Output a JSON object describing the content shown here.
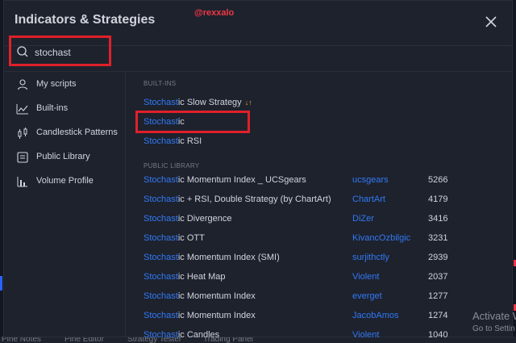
{
  "dialog": {
    "title": "Indicators & Strategies",
    "watermark": "@rexxalo"
  },
  "search": {
    "value": "stochast"
  },
  "sidebar": {
    "items": [
      {
        "label": "My scripts",
        "icon": "user-icon"
      },
      {
        "label": "Built-ins",
        "icon": "chart-line-icon"
      },
      {
        "label": "Candlestick Patterns",
        "icon": "candlestick-icon"
      },
      {
        "label": "Public Library",
        "icon": "library-icon"
      },
      {
        "label": "Volume Profile",
        "icon": "volume-profile-icon"
      }
    ]
  },
  "builtins": {
    "header": "BUILT-INS",
    "items": [
      {
        "match": "Stochast",
        "rest": "ic Slow Strategy",
        "badge": "↓↑"
      },
      {
        "match": "Stochast",
        "rest": "ic"
      },
      {
        "match": "Stochast",
        "rest": "ic RSI"
      }
    ]
  },
  "public_library": {
    "header": "PUBLIC LIBRARY",
    "items": [
      {
        "match": "Stochast",
        "rest": "ic Momentum Index _ UCSgears",
        "author": "ucsgears",
        "count": "5266"
      },
      {
        "match": "Stochast",
        "rest": "ic + RSI, Double Strategy (by ChartArt)",
        "author": "ChartArt",
        "count": "4179"
      },
      {
        "match": "Stochast",
        "rest": "ic Divergence",
        "author": "DiZer",
        "count": "3416"
      },
      {
        "match": "Stochast",
        "rest": "ic OTT",
        "author": "KivancOzbilgic",
        "count": "3231"
      },
      {
        "match": "Stochast",
        "rest": "ic Momentum Index (SMI)",
        "author": "surjithctly",
        "count": "2939"
      },
      {
        "match": "Stochast",
        "rest": "ic Heat Map",
        "author": "Violent",
        "count": "2037"
      },
      {
        "match": "Stochast",
        "rest": "ic Momentum Index",
        "author": "everget",
        "count": "1277"
      },
      {
        "match": "Stochast",
        "rest": "ic Momentum Index",
        "author": "JacobAmos",
        "count": "1274"
      },
      {
        "match": "Stochast",
        "rest": "ic Candles",
        "author": "Violent",
        "count": "1040"
      }
    ]
  },
  "background": {
    "bottom_tabs": [
      "Pine Notes",
      "Pine Editor",
      "Strategy Tester",
      "Trading Panel"
    ],
    "activate_title": "Activate W",
    "activate_sub": "Go to Settin"
  },
  "colors": {
    "accent_blue": "#3179f5",
    "highlight_red": "#e0202a",
    "dialog_bg": "#1e222d"
  }
}
